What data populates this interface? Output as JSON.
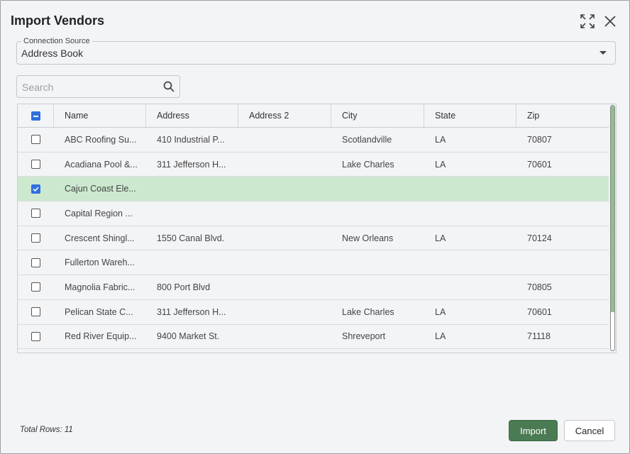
{
  "dialog": {
    "title": "Import Vendors",
    "expand_icon": "expand-icon",
    "close_icon": "close-icon"
  },
  "connection": {
    "label": "Connection Source",
    "value": "Address Book"
  },
  "search": {
    "placeholder": "Search",
    "value": ""
  },
  "grid": {
    "headers": [
      "Name",
      "Address",
      "Address 2",
      "City",
      "State",
      "Zip"
    ],
    "header_checkbox_state": "indeterminate",
    "rows": [
      {
        "checked": false,
        "name": "ABC Roofing Su...",
        "address": "410 Industrial P...",
        "address2": "",
        "city": "Scotlandville",
        "state": "LA",
        "zip": "70807"
      },
      {
        "checked": false,
        "name": "Acadiana Pool &...",
        "address": "311 Jefferson H...",
        "address2": "",
        "city": "Lake Charles",
        "state": "LA",
        "zip": "70601"
      },
      {
        "checked": true,
        "name": "Cajun Coast Ele...",
        "address": "",
        "address2": "",
        "city": "",
        "state": "",
        "zip": ""
      },
      {
        "checked": false,
        "name": "Capital Region ...",
        "address": "",
        "address2": "",
        "city": "",
        "state": "",
        "zip": ""
      },
      {
        "checked": false,
        "name": "Crescent Shingl...",
        "address": "1550 Canal Blvd.",
        "address2": "",
        "city": "New Orleans",
        "state": "LA",
        "zip": "70124"
      },
      {
        "checked": false,
        "name": "Fullerton Wareh...",
        "address": "",
        "address2": "",
        "city": "",
        "state": "",
        "zip": ""
      },
      {
        "checked": false,
        "name": "Magnolia Fabric...",
        "address": "800 Port Blvd",
        "address2": "",
        "city": "",
        "state": "",
        "zip": "70805"
      },
      {
        "checked": false,
        "name": "Pelican State C...",
        "address": "311 Jefferson H...",
        "address2": "",
        "city": "Lake Charles",
        "state": "LA",
        "zip": "70601"
      },
      {
        "checked": false,
        "name": "Red River Equip...",
        "address": "9400 Market St.",
        "address2": "",
        "city": "Shreveport",
        "state": "LA",
        "zip": "71118"
      }
    ]
  },
  "footer": {
    "total_rows": "Total Rows: 11",
    "import_label": "Import",
    "cancel_label": "Cancel"
  },
  "colors": {
    "accent": "#4a7b52",
    "selected_row": "#cce9cf",
    "checkbox": "#2f6fde"
  }
}
